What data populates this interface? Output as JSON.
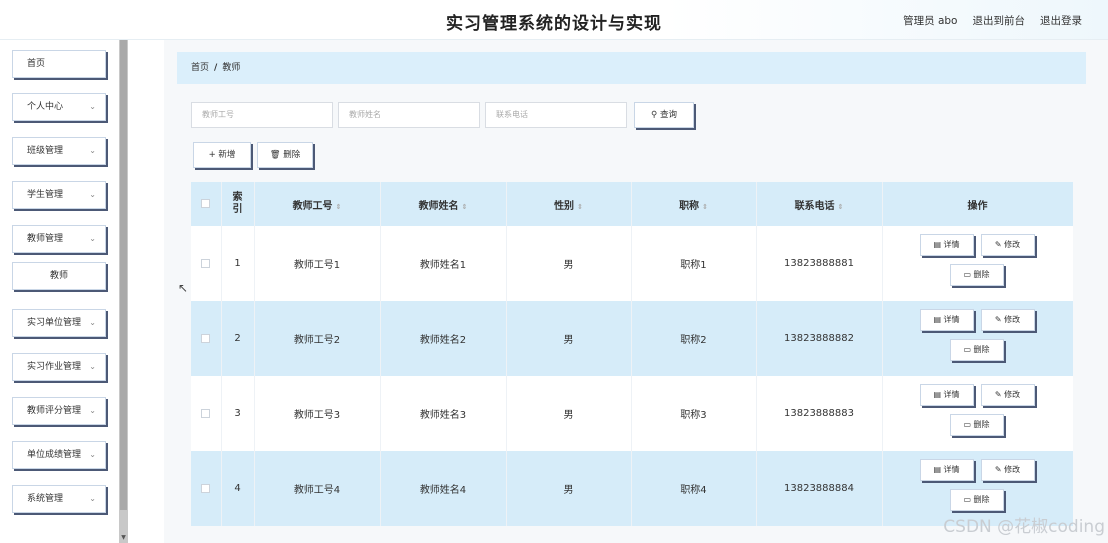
{
  "header": {
    "title": "实习管理系统的设计与实现",
    "user": "管理员 abo",
    "to_front": "退出到前台",
    "logout": "退出登录"
  },
  "sidebar": {
    "items": [
      {
        "label": "首页",
        "chevron": false
      },
      {
        "label": "个人中心",
        "chevron": true
      },
      {
        "label": "班级管理",
        "chevron": true
      },
      {
        "label": "学生管理",
        "chevron": true
      },
      {
        "label": "教师管理",
        "chevron": true
      },
      {
        "label": "教师",
        "chevron": false,
        "sub": true
      },
      {
        "label": "实习单位管理",
        "chevron": true
      },
      {
        "label": "实习作业管理",
        "chevron": true
      },
      {
        "label": "教师评分管理",
        "chevron": true
      },
      {
        "label": "单位成绩管理",
        "chevron": true
      },
      {
        "label": "系统管理",
        "chevron": true
      }
    ]
  },
  "breadcrumb": {
    "home": "首页",
    "sep": "/",
    "current": "教师"
  },
  "search": {
    "id_placeholder": "教师工号",
    "name_placeholder": "教师姓名",
    "phone_placeholder": "联系电话",
    "query_label": "查询"
  },
  "actions": {
    "add_label": "新增",
    "delete_label": "删除"
  },
  "table": {
    "headers": {
      "index": "索引",
      "id": "教师工号",
      "name": "教师姓名",
      "gender": "性别",
      "title": "职称",
      "phone": "联系电话",
      "ops": "操作"
    },
    "op_labels": {
      "detail": "详情",
      "edit": "修改",
      "delete": "删除"
    },
    "rows": [
      {
        "index": "1",
        "id": "教师工号1",
        "name": "教师姓名1",
        "gender": "男",
        "title": "职称1",
        "phone": "13823888881"
      },
      {
        "index": "2",
        "id": "教师工号2",
        "name": "教师姓名2",
        "gender": "男",
        "title": "职称2",
        "phone": "13823888882"
      },
      {
        "index": "3",
        "id": "教师工号3",
        "name": "教师姓名3",
        "gender": "男",
        "title": "职称3",
        "phone": "13823888883"
      },
      {
        "index": "4",
        "id": "教师工号4",
        "name": "教师姓名4",
        "gender": "男",
        "title": "职称4",
        "phone": "13823888884"
      }
    ]
  },
  "watermark": "CSDN @花椒coding"
}
